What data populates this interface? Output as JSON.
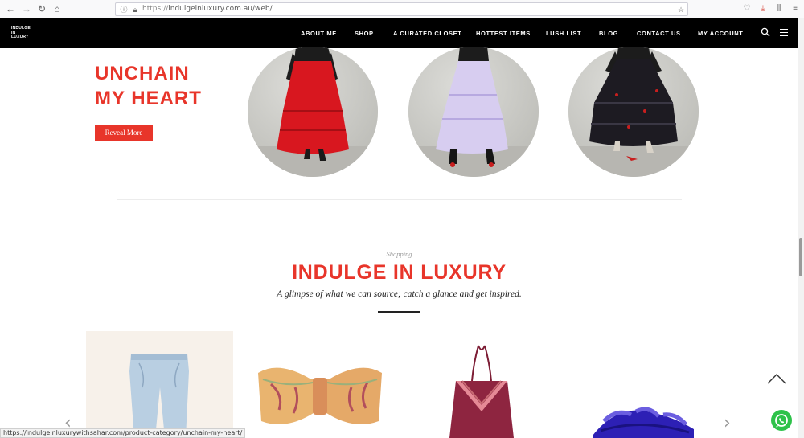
{
  "browser": {
    "url_scheme": "https://",
    "url_rest": "indulgeinluxury.com.au/web/",
    "status_url": "https://indulgeinluxurywithsahar.com/product-category/unchain-my-heart/"
  },
  "header": {
    "logo_lines": [
      "INDULGE",
      "IN",
      "LUXURY"
    ],
    "nav": [
      "ABOUT ME",
      "SHOP",
      "A CURATED CLOSET",
      "HOTTEST ITEMS",
      "LUSH LIST",
      "BLOG",
      "CONTACT US",
      "MY ACCOUNT"
    ]
  },
  "hero": {
    "title_line1": "UNCHAIN",
    "title_line2": "MY HEART",
    "button_label": "Reveal More"
  },
  "section": {
    "kicker": "Shopping",
    "title": "INDULGE IN LUXURY",
    "subtitle": "A glimpse of what we can source; catch a glance and get inspired."
  },
  "colors": {
    "accent": "#e8352a",
    "header_bg": "#000000",
    "whatsapp": "#2ec24a"
  },
  "icons": [
    "back-icon",
    "forward-icon",
    "reload-icon",
    "home-icon",
    "search-icon",
    "menu-icon",
    "chevron-left-icon",
    "chevron-right-icon",
    "scroll-top-icon",
    "whatsapp-icon"
  ]
}
